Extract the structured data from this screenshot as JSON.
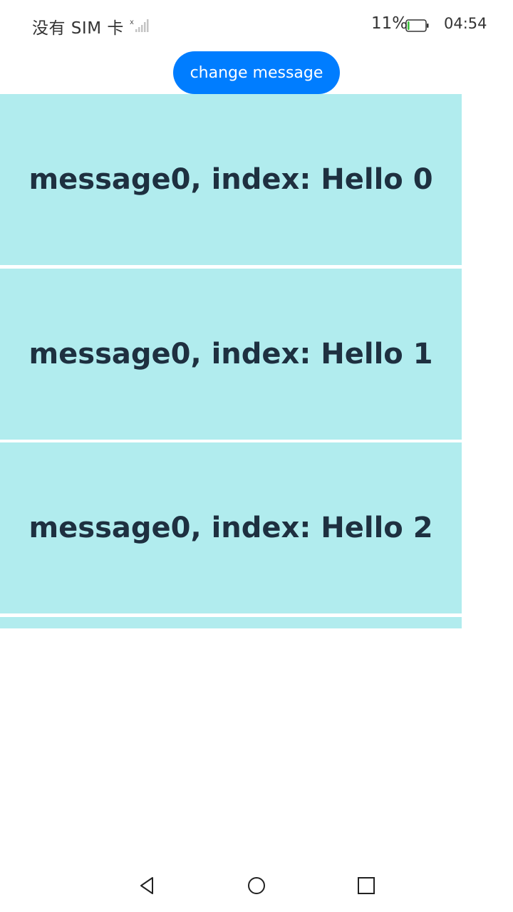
{
  "status_bar": {
    "carrier": "没有 SIM 卡",
    "battery_percent": "11%",
    "time": "04:54",
    "icons": [
      "signal-icon",
      "battery-icon"
    ],
    "battery_level": 0.11
  },
  "toolbar": {
    "change_label": "change message"
  },
  "list": {
    "items": [
      {
        "label": "message0, index: Hello 0"
      },
      {
        "label": "message0, index: Hello 1"
      },
      {
        "label": "message0, index: Hello 2"
      },
      {
        "label": ""
      }
    ]
  },
  "nav_bar": {
    "icons": [
      "back-icon",
      "home-icon",
      "recents-icon"
    ]
  },
  "colors": {
    "accent": "#007dff",
    "item_background": "#b1ecee",
    "item_text": "#1e3040"
  }
}
